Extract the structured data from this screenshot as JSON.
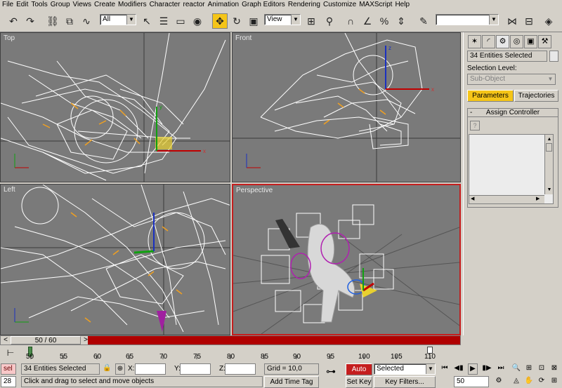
{
  "menu": [
    "File",
    "Edit",
    "Tools",
    "Group",
    "Views",
    "Create",
    "Modifiers",
    "Character",
    "reactor",
    "Animation",
    "Graph Editors",
    "Rendering",
    "Customize",
    "MAXScript",
    "Help"
  ],
  "toolbar": {
    "selection_filter": "All",
    "ref_coord": "View",
    "named_selection": ""
  },
  "viewports": {
    "top": "Top",
    "front": "Front",
    "left": "Left",
    "perspective": "Perspective"
  },
  "command_panel": {
    "selection_name": "34 Entities Selected",
    "selection_level_label": "Selection Level:",
    "sub_object": "Sub-Object",
    "parameters_tab": "Parameters",
    "trajectories_tab": "Trajectories",
    "rollout_title": "Assign Controller",
    "rollout_toggle": "-"
  },
  "timeline": {
    "slider_label": "50 / 60",
    "ticks": [
      "50",
      "55",
      "60",
      "65",
      "70",
      "75",
      "80",
      "85",
      "90",
      "95",
      "100",
      "105",
      "110"
    ]
  },
  "status": {
    "script_prefix": "sel",
    "frame_num": "28",
    "selection_text": "34 Entities Selected",
    "prompt": "Click and drag to select and move objects",
    "x_label": "X:",
    "y_label": "Y:",
    "z_label": "Z:",
    "x_value": "",
    "y_value": "",
    "z_value": "",
    "grid": "Grid = 10,0",
    "add_time_tag": "Add Time Tag",
    "auto_key": "Auto Key",
    "set_key": "Set Key",
    "key_mode": "Selected",
    "key_filters": "Key Filters...",
    "current_frame": "50"
  },
  "colors": {
    "viewport_bg": "#7a7a7a",
    "active_border": "#c41e1e",
    "timeline_red": "#b00000",
    "highlight": "#f5c518"
  }
}
